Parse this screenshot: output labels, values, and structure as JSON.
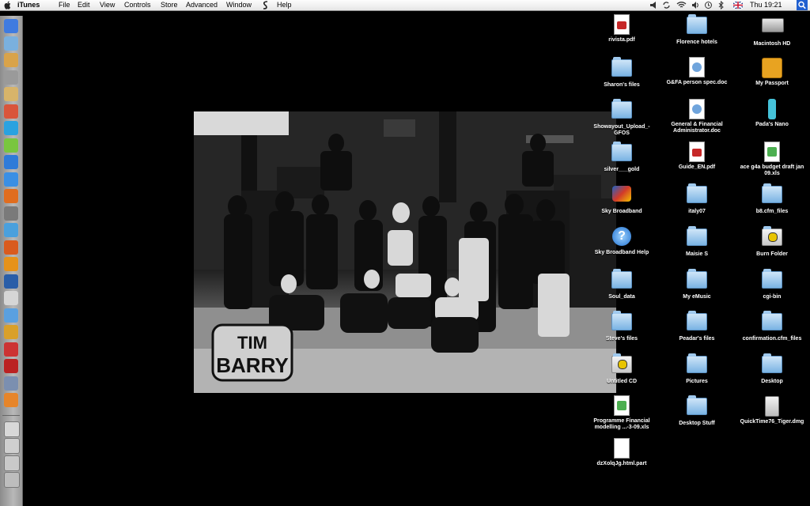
{
  "menubar": {
    "app": "iTunes",
    "items": [
      "File",
      "Edit",
      "View",
      "Controls",
      "Store",
      "Advanced",
      "Window",
      "Help"
    ],
    "clock": "Thu 19:21"
  },
  "dock": {
    "apps": [
      {
        "name": "finder",
        "color": "#3f7be0"
      },
      {
        "name": "mail",
        "color": "#7ab0de"
      },
      {
        "name": "iphoto",
        "color": "#d9a34a"
      },
      {
        "name": "address-book",
        "color": "#9a9a9a"
      },
      {
        "name": "preview",
        "color": "#d8b46a"
      },
      {
        "name": "ical",
        "color": "#d9553b"
      },
      {
        "name": "skype",
        "color": "#2aa2e0"
      },
      {
        "name": "ichat",
        "color": "#79c63f"
      },
      {
        "name": "word",
        "color": "#2f7bd9"
      },
      {
        "name": "itunes",
        "color": "#3a8fe4"
      },
      {
        "name": "firefox",
        "color": "#e06d1f"
      },
      {
        "name": "system-prefs",
        "color": "#7a7a7a"
      },
      {
        "name": "sync",
        "color": "#4aa0dd"
      },
      {
        "name": "messenger",
        "color": "#d95b1e"
      },
      {
        "name": "vlc",
        "color": "#e6921a"
      },
      {
        "name": "photoshop",
        "color": "#2a5ea8"
      },
      {
        "name": "textedit",
        "color": "#d6d6d6"
      },
      {
        "name": "safari",
        "color": "#5aa0e0"
      },
      {
        "name": "time-machine",
        "color": "#d9a02a"
      },
      {
        "name": "chess",
        "color": "#cc3333"
      },
      {
        "name": "photo-booth",
        "color": "#bb2222"
      },
      {
        "name": "iphoto-2",
        "color": "#7b8fb0"
      },
      {
        "name": "phone",
        "color": "#e6852a"
      }
    ],
    "others": [
      {
        "name": "downloads",
        "color": "#d8d8d8"
      },
      {
        "name": "documents",
        "color": "#cfcfcf"
      },
      {
        "name": "applications",
        "color": "#c9c9c9"
      },
      {
        "name": "trash",
        "color": "#bdbdbd"
      }
    ]
  },
  "wallpaper": {
    "logo_text": "TIM BARRY"
  },
  "desktop_icons": [
    {
      "label": "rivista.pdf",
      "kind": "pdf"
    },
    {
      "label": "Florence hotels",
      "kind": "folder"
    },
    {
      "label": "Macintosh HD",
      "kind": "drive"
    },
    {
      "label": "Sharon's files",
      "kind": "folder"
    },
    {
      "label": "G&FA person spec.doc",
      "kind": "doc"
    },
    {
      "label": "My Passport",
      "kind": "ext-drive"
    },
    {
      "label": "Showayout_Upload_-GFOS",
      "kind": "folder"
    },
    {
      "label": "General & Financial Administrator.doc",
      "kind": "doc"
    },
    {
      "label": "Pada's Nano",
      "kind": "ipod"
    },
    {
      "label": "silver___gold",
      "kind": "folder"
    },
    {
      "label": "Guide_EN.pdf",
      "kind": "pdf"
    },
    {
      "label": "ace g4a budget draft jan 09.xls",
      "kind": "xls"
    },
    {
      "label": "Sky Broadband",
      "kind": "app-sky"
    },
    {
      "label": "italy07",
      "kind": "folder"
    },
    {
      "label": "b8.cfm_files",
      "kind": "folder"
    },
    {
      "label": "Sky Broadband Help",
      "kind": "help"
    },
    {
      "label": "Maisie S",
      "kind": "folder"
    },
    {
      "label": "Burn Folder",
      "kind": "burn"
    },
    {
      "label": "Soul_data",
      "kind": "folder"
    },
    {
      "label": "My eMusic",
      "kind": "folder"
    },
    {
      "label": "cgi-bin",
      "kind": "folder"
    },
    {
      "label": "Steve's files",
      "kind": "folder"
    },
    {
      "label": "Peadar's files",
      "kind": "folder"
    },
    {
      "label": "confirmation.cfm_files",
      "kind": "folder"
    },
    {
      "label": "Untitled CD",
      "kind": "burn"
    },
    {
      "label": "Pictures",
      "kind": "folder"
    },
    {
      "label": "Desktop",
      "kind": "folder"
    },
    {
      "label": "Programme Financial modelling ...-3-09.xls",
      "kind": "xls"
    },
    {
      "label": "Desktop Stuff",
      "kind": "folder"
    },
    {
      "label": "QuickTime76_Tiger.dmg",
      "kind": "dmg"
    },
    {
      "label": "dzXolqJg.html.part",
      "kind": "file"
    }
  ]
}
